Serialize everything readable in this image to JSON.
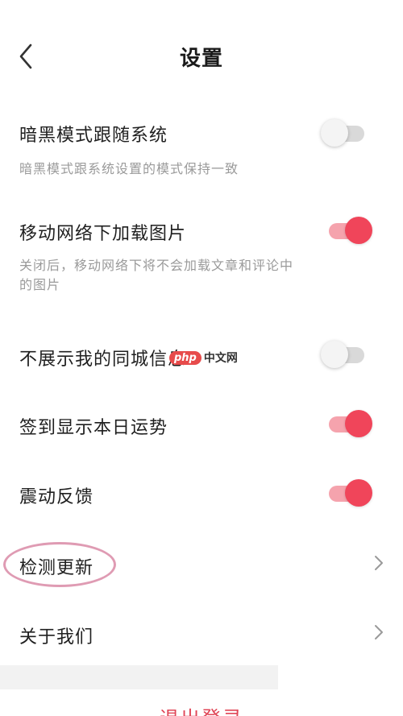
{
  "header": {
    "title": "设置",
    "back_icon": "chevron-left-icon"
  },
  "settings": {
    "dark_mode": {
      "title": "暗黑模式跟随系统",
      "desc": "暗黑模式跟系统设置的模式保持一致",
      "enabled": false
    },
    "mobile_images": {
      "title": "移动网络下加载图片",
      "desc": "关闭后，移动网络下将不会加载文章和评论中的图片",
      "enabled": true
    },
    "hide_city": {
      "title": "不展示我的同城信息",
      "enabled": false
    },
    "daily_fortune": {
      "title": "签到显示本日运势",
      "enabled": true
    },
    "vibration": {
      "title": "震动反馈",
      "enabled": true
    },
    "check_update": {
      "title": "检测更新"
    },
    "about": {
      "title": "关于我们"
    }
  },
  "watermark": {
    "badge": "php",
    "text": "中文网"
  },
  "logout_label": "退出登录",
  "colors": {
    "accent": "#f0455a",
    "accent_track": "#f5a3ad",
    "off_track": "#d9d9d9",
    "desc_text": "#9a9a9a"
  }
}
